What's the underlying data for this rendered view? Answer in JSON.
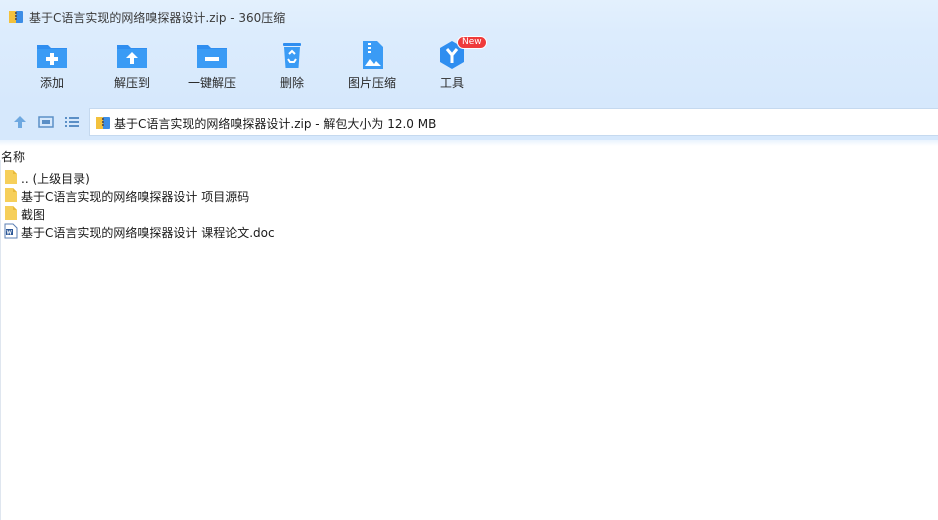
{
  "window": {
    "title": "基于C语言实现的网络嗅探器设计.zip - 360压缩"
  },
  "toolbar": {
    "items": [
      {
        "label": "添加",
        "icon": "add-folder-icon"
      },
      {
        "label": "解压到",
        "icon": "extract-to-icon"
      },
      {
        "label": "一键解压",
        "icon": "one-click-extract-icon"
      },
      {
        "label": "删除",
        "icon": "recycle-bin-icon"
      },
      {
        "label": "图片压缩",
        "icon": "image-compress-icon"
      },
      {
        "label": "工具",
        "icon": "tools-icon",
        "badge": "New"
      }
    ]
  },
  "addressbar": {
    "path": "基于C语言实现的网络嗅探器设计.zip - 解包大小为 12.0 MB"
  },
  "filelist": {
    "column_name": "名称",
    "rows": [
      {
        "name": ".. (上级目录)",
        "icon": "folder-icon"
      },
      {
        "name": "基于C语言实现的网络嗅探器设计 项目源码",
        "icon": "folder-icon"
      },
      {
        "name": "截图",
        "icon": "folder-icon"
      },
      {
        "name": "基于C语言实现的网络嗅探器设计 课程论文.doc",
        "icon": "word-doc-icon"
      }
    ]
  },
  "colors": {
    "accent": "#2a8ff0",
    "toolbar_bg": "#dcecfd",
    "badge": "#ef3b3b"
  }
}
